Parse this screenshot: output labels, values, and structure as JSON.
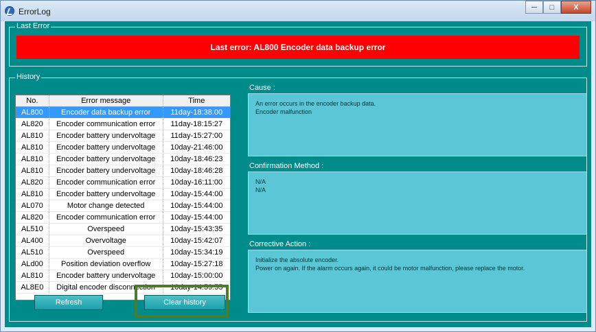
{
  "window": {
    "title": "ErrorLog",
    "buttons": {
      "minimize": "─",
      "maximize": "□",
      "close": "X"
    }
  },
  "last_error": {
    "group_label": "Last Error",
    "message": "Last error: AL800 Encoder data backup error",
    "banner_color": "#ff0000"
  },
  "history": {
    "group_label": "History",
    "columns": [
      "No.",
      "Error message",
      "Time"
    ],
    "rows": [
      {
        "no": "AL800",
        "msg": "Encoder data backup error",
        "time": "11day-18:38:00"
      },
      {
        "no": "AL820",
        "msg": "Encoder communication error",
        "time": "11day-18:15:27"
      },
      {
        "no": "AL810",
        "msg": "Encoder battery undervoltage",
        "time": "11day-15:27:00"
      },
      {
        "no": "AL810",
        "msg": "Encoder battery undervoltage",
        "time": "10day-21:46:00"
      },
      {
        "no": "AL810",
        "msg": "Encoder battery undervoltage",
        "time": "10day-18:46:23"
      },
      {
        "no": "AL810",
        "msg": "Encoder battery undervoltage",
        "time": "10day-18:46:28"
      },
      {
        "no": "AL820",
        "msg": "Encoder communication error",
        "time": "10day-16:11:00"
      },
      {
        "no": "AL810",
        "msg": "Encoder battery undervoltage",
        "time": "10day-15:44:00"
      },
      {
        "no": "AL070",
        "msg": "Motor change detected",
        "time": "10day-15:44:00"
      },
      {
        "no": "AL820",
        "msg": "Encoder communication error",
        "time": "10day-15:44:00"
      },
      {
        "no": "AL510",
        "msg": "Overspeed",
        "time": "10day-15:43:35"
      },
      {
        "no": "AL400",
        "msg": "Overvoltage",
        "time": "10day-15:42:07"
      },
      {
        "no": "AL510",
        "msg": "Overspeed",
        "time": "10day-15:34:19"
      },
      {
        "no": "ALd00",
        "msg": "Position deviation overflow",
        "time": "10day-15:27:18"
      },
      {
        "no": "AL810",
        "msg": "Encoder battery undervoltage",
        "time": "10day-15:00:00"
      },
      {
        "no": "AL8E0",
        "msg": "Digital encoder disconnection",
        "time": "10day-14:59:55"
      }
    ],
    "selected_index": 0,
    "refresh_label": "Refresh",
    "clear_label": "Clear history",
    "highlight_color": "#4b7c2d"
  },
  "cause": {
    "label": "Cause :",
    "lines": [
      "An error occurs in the encoder backup data.",
      "Encoder malfunction"
    ]
  },
  "confirmation": {
    "label": "Confirmation Method :",
    "lines": [
      "N/A",
      "N/A"
    ]
  },
  "corrective": {
    "label": "Corrective Action :",
    "lines": [
      "Initialize the absolute encoder.",
      "Power on again. If the alarm occurs again, it could be motor malfunction, please replace the motor."
    ]
  },
  "colors": {
    "client_bg": "#008b8b",
    "panel_bg": "#5bc7d6",
    "selected_row": "#3399ff"
  }
}
